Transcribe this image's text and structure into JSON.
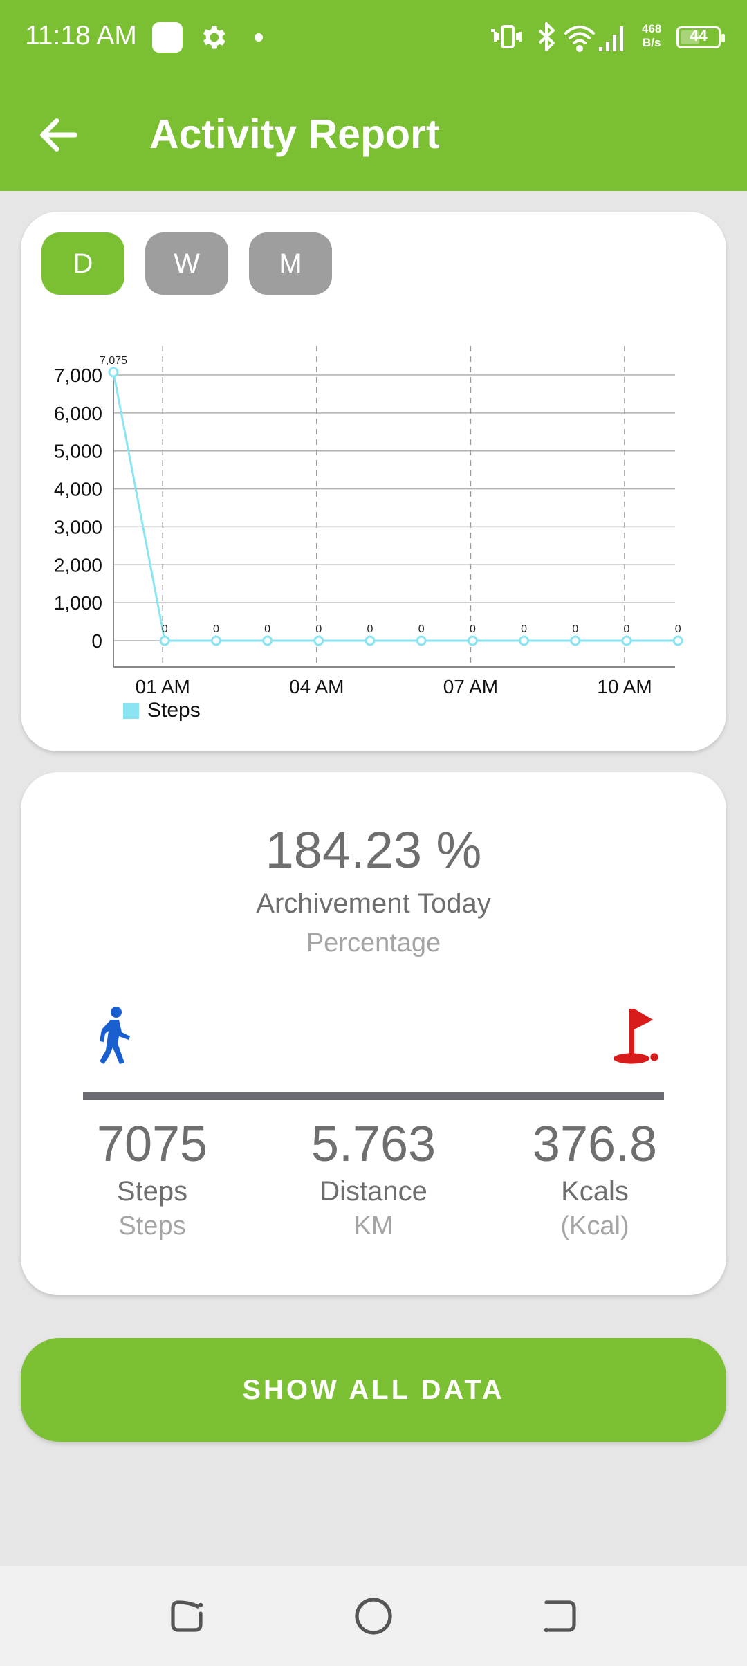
{
  "status_bar": {
    "time": "11:18 AM",
    "net_speed_value": "468",
    "net_speed_unit": "B/s",
    "battery": "44",
    "icons": [
      "notification-square-icon",
      "gear-icon",
      "dot-icon",
      "vibrate-icon",
      "bluetooth-icon",
      "wifi-icon",
      "signal-icon",
      "battery-icon"
    ]
  },
  "header": {
    "title": "Activity Report",
    "back_icon": "arrow-left-icon",
    "background": "#7bbf33"
  },
  "period_tabs": [
    {
      "label": "D",
      "active": true
    },
    {
      "label": "W",
      "active": false
    },
    {
      "label": "M",
      "active": false
    }
  ],
  "chart_data": {
    "type": "line",
    "x": [
      "12 AM",
      "01 AM",
      "02 AM",
      "03 AM",
      "04 AM",
      "05 AM",
      "06 AM",
      "07 AM",
      "08 AM",
      "09 AM",
      "10 AM",
      "11 AM"
    ],
    "x_tick_labels": [
      "01 AM",
      "04 AM",
      "07 AM",
      "10 AM"
    ],
    "y_tick_labels": [
      "0",
      "1,000",
      "2,000",
      "3,000",
      "4,000",
      "5,000",
      "6,000",
      "7,000"
    ],
    "series": [
      {
        "name": "Steps",
        "color": "#8ae4f2",
        "values": [
          7075,
          0,
          0,
          0,
          0,
          0,
          0,
          0,
          0,
          0,
          0,
          0
        ],
        "data_labels": [
          "7,075",
          "0",
          "0",
          "0",
          "0",
          "0",
          "0",
          "0",
          "0",
          "0",
          "0",
          "0"
        ]
      }
    ],
    "ylim": [
      0,
      7000
    ],
    "grid": true,
    "legend": "bottom-left"
  },
  "achievement": {
    "percentage": "184.23 %",
    "label": "Archivement Today",
    "sub_label": "Percentage",
    "progress": 1.0,
    "walk_icon": "walking-person-icon",
    "flag_icon": "golf-flag-icon"
  },
  "stats": [
    {
      "value": "7075",
      "name": "Steps",
      "unit": "Steps"
    },
    {
      "value": "5.763",
      "name": "Distance",
      "unit": "KM"
    },
    {
      "value": "376.8",
      "name": "Kcals",
      "unit": "(Kcal)"
    }
  ],
  "show_all_button": "SHOW ALL DATA",
  "nav_bar": [
    "recents-icon",
    "home-icon",
    "back-icon"
  ]
}
